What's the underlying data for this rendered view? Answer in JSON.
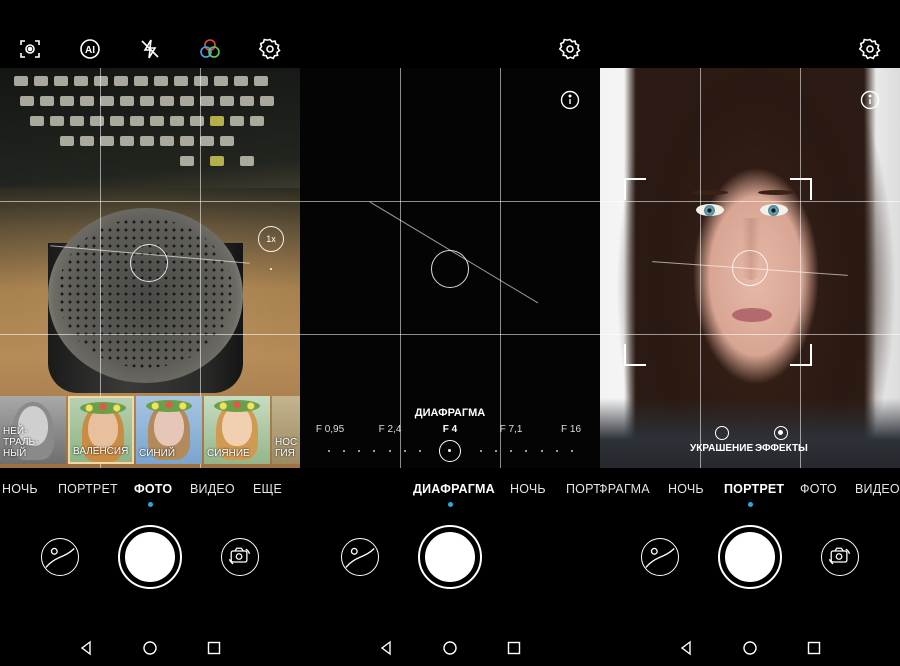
{
  "colors": {
    "accent": "#27a9e1",
    "background": "#000000"
  },
  "panel1": {
    "top_icons": [
      "camera-frame-icon",
      "ai-icon",
      "flash-off-icon",
      "color-filter-icon",
      "settings-icon"
    ],
    "zoom_badge": "1x",
    "filters": [
      {
        "label": "НЕЙ-\nТРАЛЬ-\nНЫЙ",
        "selected": false
      },
      {
        "label": "ВАЛЕНСИЯ",
        "selected": true
      },
      {
        "label": "СИНИЙ",
        "selected": false
      },
      {
        "label": "СИЯНИЕ",
        "selected": false
      },
      {
        "label": "НОС\nГИЯ",
        "selected": false
      }
    ],
    "modes": [
      "НОЧЬ",
      "ПОРТРЕТ",
      "ФОТО",
      "ВИДЕО",
      "ЕЩЕ"
    ],
    "active_mode": "ФОТО"
  },
  "panel2": {
    "top_icons": [
      "settings-icon"
    ],
    "aperture_title": "ДИАФРАГМА",
    "aperture_labels": [
      "F 0,95",
      "F 2,4",
      "F 4",
      "F 7,1",
      "F 16"
    ],
    "aperture_selected": "F 4",
    "modes": [
      "ДИАФРАГМА",
      "НОЧЬ",
      "ПОРТ"
    ],
    "active_mode": "ДИАФРАГМА"
  },
  "panel3": {
    "top_icons": [
      "settings-icon"
    ],
    "beauty_label": "УКРАШЕНИЕ",
    "effects_label": "ЭФФЕКТЫ",
    "modes": [
      "ФРАГМА",
      "НОЧЬ",
      "ПОРТРЕТ",
      "ФОТО",
      "ВИДЕО"
    ],
    "active_mode": "ПОРТРЕТ"
  }
}
